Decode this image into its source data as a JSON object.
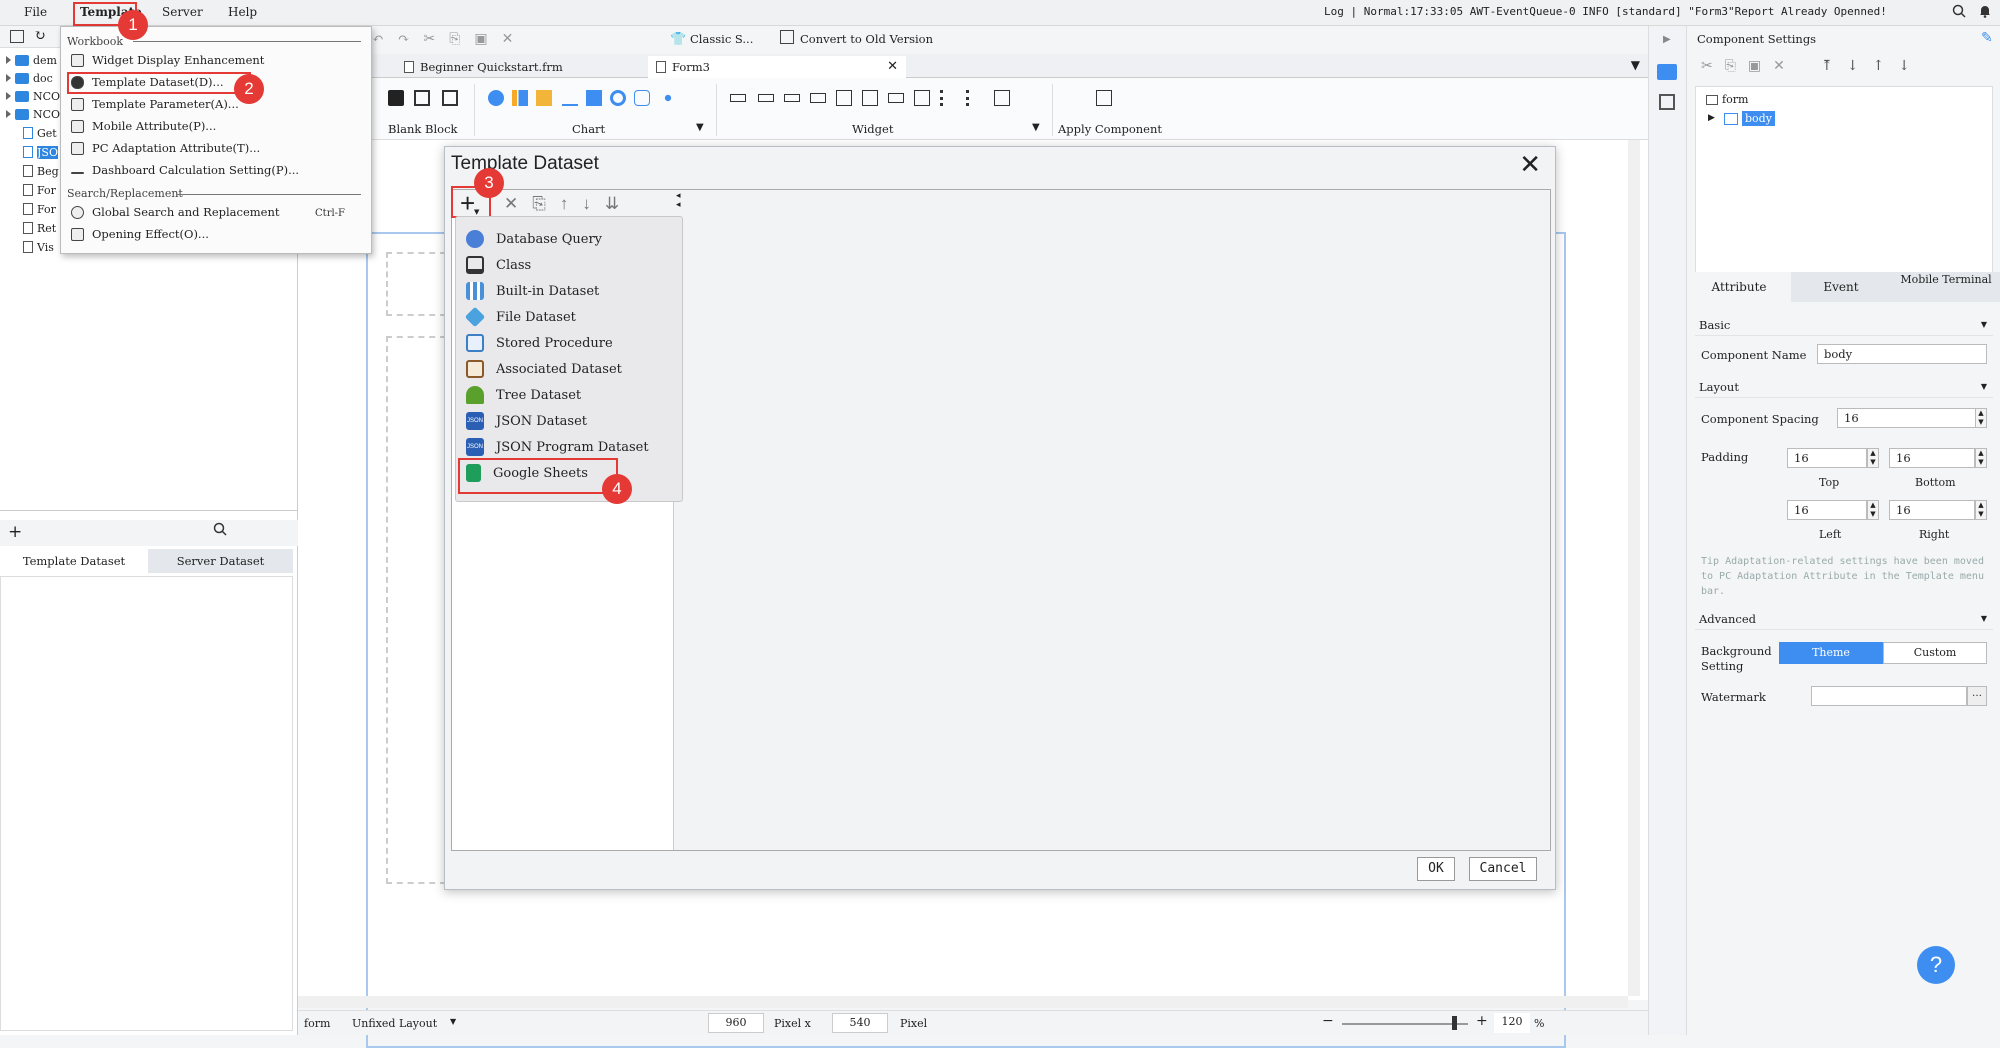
{
  "menubar": {
    "items": [
      "File",
      "Template",
      "Server",
      "Help"
    ],
    "log_message": "Log | Normal:17:33:05 AWT-EventQueue-0 INFO [standard] \"Form3\"Report Already Openned!"
  },
  "template_menu": {
    "workbook_label": "Workbook",
    "items": [
      {
        "label": "Widget Display Enhancement",
        "icon": "widget-icon"
      },
      {
        "label": "Template Dataset(D)...",
        "icon": "database-icon"
      },
      {
        "label": "Template Parameter(A)...",
        "icon": "parameter-icon"
      },
      {
        "label": "Mobile Attribute(P)...",
        "icon": "mobile-icon"
      },
      {
        "label": "PC Adaptation Attribute(T)...",
        "icon": "pc-icon"
      },
      {
        "label": "Dashboard Calculation Setting(P)...",
        "icon": "calc-icon"
      }
    ],
    "search_label": "Search/Replacement",
    "search_items": [
      {
        "label": "Global Search and Replacement",
        "shortcut": "Ctrl-F",
        "icon": "search-icon"
      },
      {
        "label": "Opening Effect(O)...",
        "icon": "play-icon"
      }
    ]
  },
  "tree_items": [
    "dem",
    "doc",
    "NCO",
    "NCO",
    "Get",
    "JSO",
    "Beg",
    "For",
    "For",
    "Ret",
    "Vis"
  ],
  "left_tabs": [
    "Template Dataset",
    "Server Dataset"
  ],
  "toolbar": {
    "classic": "Classic S...",
    "convert": "Convert to Old Version"
  },
  "tabs": [
    "Beginner Quickstart.frm",
    "Form3"
  ],
  "ribbon": {
    "blank_block": "Blank Block",
    "chart": "Chart",
    "widget": "Widget",
    "apply_component": "Apply Component"
  },
  "dialog": {
    "title": "Template Dataset",
    "ok": "OK",
    "cancel": "Cancel",
    "add_menu": [
      {
        "label": "Database Query",
        "icon": "database-query-icon",
        "color": "#4a7fd8"
      },
      {
        "label": "Class",
        "icon": "class-icon",
        "color": "#333333"
      },
      {
        "label": "Built-in Dataset",
        "icon": "builtin-dataset-icon",
        "color": "#4a90d9"
      },
      {
        "label": "File Dataset",
        "icon": "file-dataset-icon",
        "color": "#4aa3df"
      },
      {
        "label": "Stored Procedure",
        "icon": "stored-procedure-icon",
        "color": "#3d7fc4"
      },
      {
        "label": "Associated Dataset",
        "icon": "associated-dataset-icon",
        "color": "#8b5a2b"
      },
      {
        "label": "Tree Dataset",
        "icon": "tree-dataset-icon",
        "color": "#5aa02c"
      },
      {
        "label": "JSON Dataset",
        "icon": "json-icon",
        "color": "#2b5fb3"
      },
      {
        "label": "JSON Program Dataset",
        "icon": "json-program-icon",
        "color": "#2b5fb3"
      },
      {
        "label": "Google Sheets",
        "icon": "google-sheets-icon",
        "color": "#1e9e5a"
      }
    ]
  },
  "badges": [
    "1",
    "2",
    "3",
    "4"
  ],
  "right_panel": {
    "title": "Component Settings",
    "tree_form": "form",
    "tree_body": "body",
    "tabs": [
      "Attribute",
      "Event",
      "Mobile Terminal"
    ],
    "basic": "Basic",
    "component_name_label": "Component Name",
    "component_name_value": "body",
    "layout": "Layout",
    "spacing_label": "Component Spacing",
    "spacing_value": "16",
    "padding_label": "Padding",
    "top": "16",
    "bottom": "16",
    "left": "16",
    "right": "16",
    "top_label": "Top",
    "bottom_label": "Bottom",
    "left_label": "Left",
    "right_label": "Right",
    "tip": "Tip  Adaptation-related settings have been moved to PC Adaptation Attribute in the Template menu bar.",
    "advanced": "Advanced",
    "bg_label": "Background Setting",
    "bg_theme": "Theme",
    "bg_custom": "Custom",
    "watermark_label": "Watermark",
    "accent": "#3d8ef0"
  },
  "statusbar": {
    "form": "form",
    "layout": "Unfixed Layout",
    "width": "960",
    "pixel_x": "Pixel x",
    "height": "540",
    "pixel": "Pixel",
    "zoom": "120",
    "percent": "%"
  },
  "help_button": "?"
}
